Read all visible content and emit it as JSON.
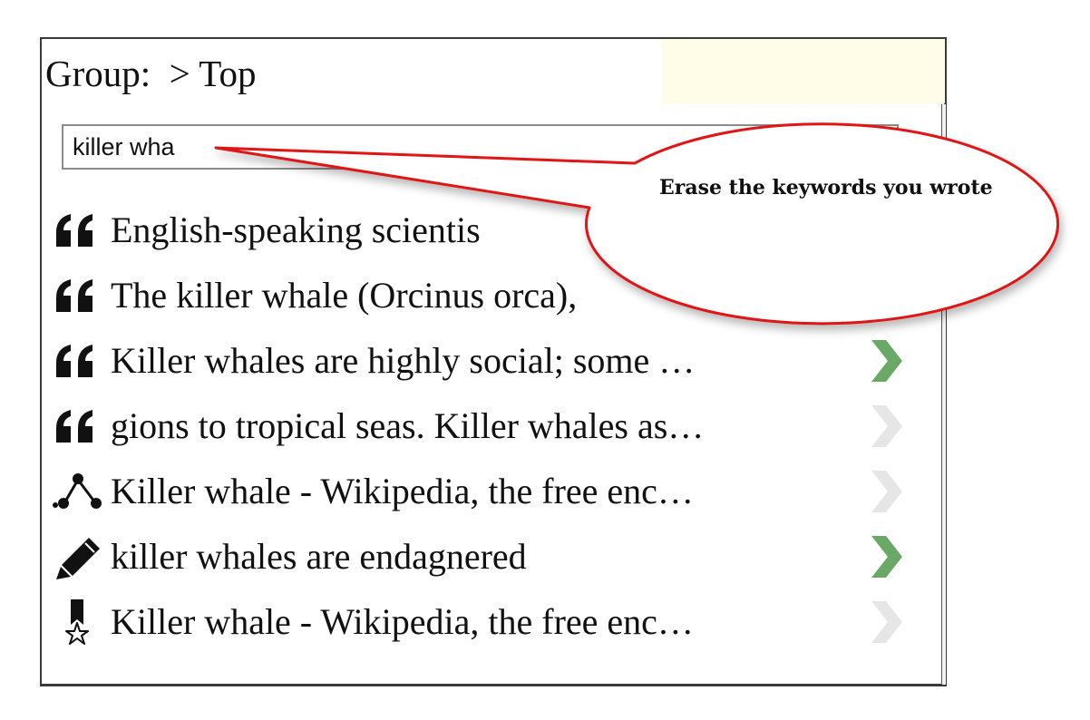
{
  "panel": {
    "group_label": "Group:  > Top",
    "search": {
      "value": "killer wha"
    },
    "results": [
      {
        "icon": "quote-icon",
        "text": "English-speaking scientis",
        "arrow": "none"
      },
      {
        "icon": "quote-icon",
        "text": "The killer whale (Orcinus orca),",
        "arrow": "none"
      },
      {
        "icon": "quote-icon",
        "text": "Killer whales are highly social; some …",
        "arrow": "green"
      },
      {
        "icon": "quote-icon",
        "text": "gions to tropical seas. Killer whales as…",
        "arrow": "faint"
      },
      {
        "icon": "network-icon",
        "text": "Killer whale - Wikipedia, the free enc…",
        "arrow": "faint"
      },
      {
        "icon": "pencil-icon",
        "text": "killer whales are endagnered",
        "arrow": "green"
      },
      {
        "icon": "bookmark-star-icon",
        "text": "Killer whale - Wikipedia, the free enc…",
        "arrow": "faint"
      }
    ]
  },
  "callout": {
    "text": "Erase the keywords you wrote"
  },
  "colors": {
    "arrow_active": "#6aa865",
    "arrow_inactive": "#e6e6e6",
    "callout_stroke": "#e01515",
    "header_highlight": "#fffde8"
  }
}
